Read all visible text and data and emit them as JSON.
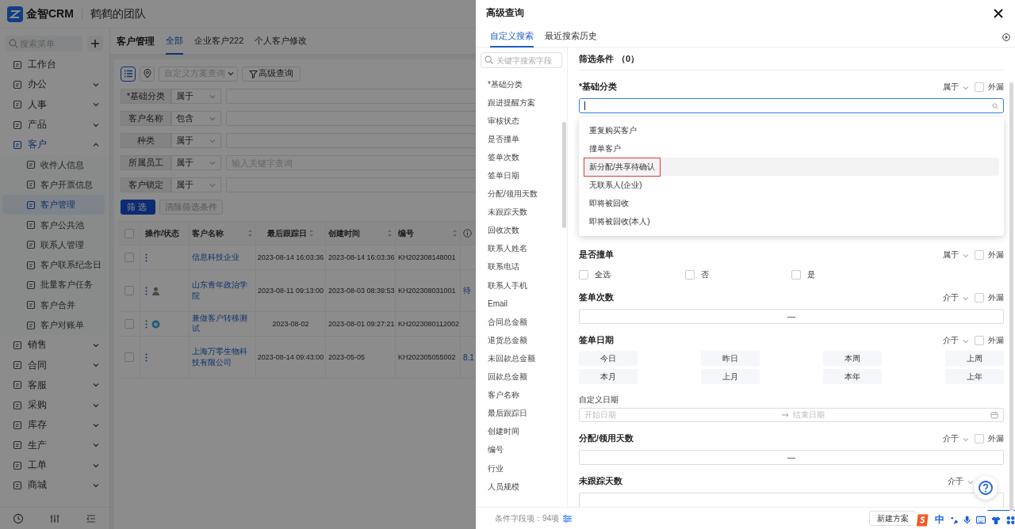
{
  "header": {
    "logo_text": "金智CRM",
    "team": "鹤鹤的团队"
  },
  "sidebar": {
    "search_placeholder": "搜索菜单",
    "items": [
      {
        "label": "工作台",
        "kind": "link",
        "selected": false
      },
      {
        "label": "办公",
        "kind": "group",
        "expanded": false
      },
      {
        "label": "人事",
        "kind": "group",
        "expanded": false
      },
      {
        "label": "产品",
        "kind": "group",
        "expanded": false
      },
      {
        "label": "客户",
        "kind": "group",
        "expanded": true,
        "children": [
          {
            "label": "收件人信息",
            "selected": false
          },
          {
            "label": "客户开票信息",
            "selected": false
          },
          {
            "label": "客户管理",
            "selected": true
          },
          {
            "label": "客户公共池",
            "selected": false
          },
          {
            "label": "联系人管理",
            "selected": false
          },
          {
            "label": "客户联系纪念日",
            "selected": false
          },
          {
            "label": "批量客户任务",
            "selected": false
          },
          {
            "label": "客户合并",
            "selected": false
          },
          {
            "label": "客户对账单",
            "selected": false
          }
        ]
      },
      {
        "label": "销售",
        "kind": "group",
        "expanded": false
      },
      {
        "label": "合同",
        "kind": "group",
        "expanded": false
      },
      {
        "label": "客服",
        "kind": "group",
        "expanded": false
      },
      {
        "label": "采购",
        "kind": "group",
        "expanded": false
      },
      {
        "label": "库存",
        "kind": "group",
        "expanded": false
      },
      {
        "label": "生产",
        "kind": "group",
        "expanded": false
      },
      {
        "label": "工单",
        "kind": "group",
        "expanded": false
      },
      {
        "label": "商城",
        "kind": "group",
        "expanded": false
      }
    ]
  },
  "page_tabs": {
    "title": "客户管理",
    "tabs": [
      {
        "label": "全部",
        "selected": true
      },
      {
        "label": "企业客户222",
        "selected": false
      },
      {
        "label": "个人客户修改",
        "selected": false
      }
    ]
  },
  "toolbar": {
    "views": [
      {
        "kind": "list",
        "selected": true
      },
      {
        "kind": "map",
        "selected": false
      }
    ],
    "scheme_placeholder": "自定义方案查询",
    "advanced_button": "高级查询"
  },
  "filters": [
    {
      "field": "*基础分类",
      "operator": "属于"
    },
    {
      "field": "客户名称",
      "operator": "包含"
    },
    {
      "field": "种类",
      "operator": "属于"
    },
    {
      "field": "所属员工",
      "operator": "属于",
      "placeholder": "输入关键字查询"
    },
    {
      "field": "客户锁定",
      "operator": "属于"
    }
  ],
  "filter_buttons": {
    "apply": "筛选",
    "clear": "清除筛选条件",
    "clear_disabled": true
  },
  "table": {
    "all_checked": false,
    "columns": [
      {
        "label": "操作/状态",
        "sortable": false
      },
      {
        "label": "客户名称",
        "sortable": true
      },
      {
        "label": "最后跟踪日",
        "sortable": true
      },
      {
        "label": "创建时间",
        "sortable": true
      },
      {
        "label": "编号",
        "sortable": true
      }
    ],
    "rows": [
      {
        "checked": false,
        "kind": "plain",
        "name": "信息科技企业",
        "last_follow": "2023-08-14 16:03:36",
        "created": "2023-08-14 16:03:36",
        "number": "KH202308148001"
      },
      {
        "checked": false,
        "kind": "person",
        "name": "山东青年政治学院",
        "last_follow": "2023-08-11 09:13:00",
        "created": "2023-08-03 08:39:53",
        "number": "KH202308031001",
        "column_7": "待"
      },
      {
        "checked": false,
        "kind": "ring",
        "name": "兼做客户转移测试",
        "last_follow": "2023-08-02",
        "created": "2023-08-01 09:27:21",
        "number": "KH2023080112002"
      },
      {
        "checked": false,
        "kind": "plain",
        "name": "上海万零生物科技有限公司",
        "last_follow": "2023-08-14 09:43:00",
        "created": "2023-05-05",
        "number": "KH202305055002",
        "column_7": "8.1"
      }
    ]
  },
  "drawer": {
    "title": "高级查询",
    "tabs": [
      {
        "label": "自定义搜索",
        "selected": true
      },
      {
        "label": "最近搜索历史",
        "selected": false
      }
    ],
    "field_search_placeholder": "关键字搜索字段",
    "fields": [
      "*基础分类",
      "跟进提醒方案",
      "审核状态",
      "是否撞单",
      "签单次数",
      "签单日期",
      "分配/领用天数",
      "未跟踪天数",
      "回收次数",
      "联系人姓名",
      "联系电话",
      "联系人手机",
      "Email",
      "合同总金额",
      "退货总金额",
      "未回款总金额",
      "回款总金额",
      "客户名称",
      "最后跟踪日",
      "创建时间",
      "编号",
      "行业",
      "人员规模"
    ],
    "conditions_title": "筛选条件",
    "conditions_count": "（0）",
    "sections": [
      {
        "kind": "select",
        "label": "*基础分类",
        "operator": "属于",
        "external_label": "外漏",
        "external_checked": false,
        "options": [
          {
            "label": "重复购买客户",
            "highlighted": false
          },
          {
            "label": "撞单客户",
            "highlighted": false
          },
          {
            "label": "新分配/共享待确认",
            "highlighted": true
          },
          {
            "label": "无联系人(企业)",
            "highlighted": false
          },
          {
            "label": "即将被回收",
            "highlighted": false
          },
          {
            "label": "即将被回收(本人)",
            "highlighted": false
          }
        ]
      },
      {
        "kind": "checkboxes",
        "label": "是否撞单",
        "operator": "属于",
        "external_label": "外漏",
        "external_checked": false,
        "choices": [
          {
            "label": "全选",
            "checked": false
          },
          {
            "label": "否",
            "checked": false
          },
          {
            "label": "是",
            "checked": false
          }
        ]
      },
      {
        "kind": "range",
        "label": "签单次数",
        "operator": "介于",
        "external_label": "外漏",
        "external_checked": false,
        "separator": "—"
      },
      {
        "kind": "date",
        "label": "签单日期",
        "operator": "介于",
        "external_label": "外漏",
        "external_checked": false,
        "presets": [
          "今日",
          "昨日",
          "本周",
          "上周",
          "本月",
          "上月",
          "本年",
          "上年"
        ],
        "custom_label": "自定义日期",
        "start_placeholder": "开始日期",
        "end_placeholder": "结束日期"
      },
      {
        "kind": "range",
        "label": "分配/领用天数",
        "operator": "介于",
        "external_label": "外漏",
        "external_checked": false,
        "separator": "—"
      },
      {
        "kind": "range",
        "label": "未跟踪天数",
        "operator": "介于"
      }
    ],
    "footer": {
      "field_count": "条件字段项：94项",
      "new_scheme": "新建方案"
    }
  },
  "ime": {
    "mode": "中"
  }
}
